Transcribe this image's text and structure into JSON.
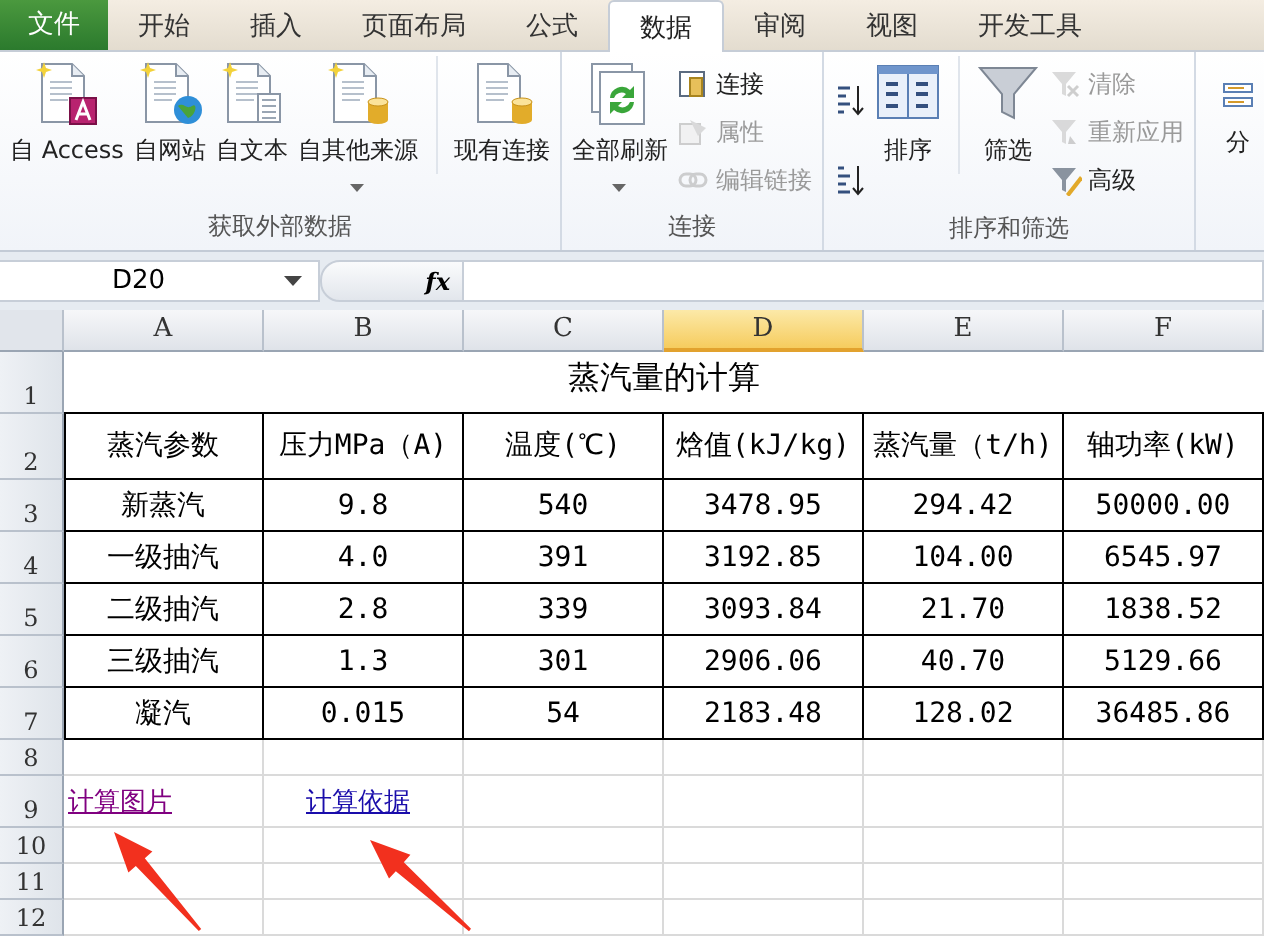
{
  "tabs": [
    {
      "label": "文件",
      "kind": "file",
      "selected": false
    },
    {
      "label": "开始",
      "kind": "tab",
      "selected": false
    },
    {
      "label": "插入",
      "kind": "tab",
      "selected": false
    },
    {
      "label": "页面布局",
      "kind": "tab",
      "selected": false
    },
    {
      "label": "公式",
      "kind": "tab",
      "selected": false
    },
    {
      "label": "数据",
      "kind": "tab",
      "selected": true
    },
    {
      "label": "审阅",
      "kind": "tab",
      "selected": false
    },
    {
      "label": "视图",
      "kind": "tab",
      "selected": false
    },
    {
      "label": "开发工具",
      "kind": "tab",
      "selected": false
    }
  ],
  "ribbon": {
    "groups": [
      {
        "label": "获取外部数据",
        "items": [
          {
            "kind": "large",
            "label": "自 Access",
            "dropdown": false
          },
          {
            "kind": "large",
            "label": "自网站",
            "dropdown": false
          },
          {
            "kind": "large",
            "label": "自文本",
            "dropdown": false
          },
          {
            "kind": "large",
            "label": "自其他来源",
            "dropdown": true
          },
          {
            "kind": "large",
            "label": "现有连接",
            "dropdown": false,
            "separated": true
          }
        ]
      },
      {
        "label": "连接",
        "items": [
          {
            "kind": "large",
            "label": "全部刷新",
            "dropdown": true
          },
          {
            "kind": "small",
            "label": "连接",
            "disabled": false
          },
          {
            "kind": "small",
            "label": "属性",
            "disabled": true
          },
          {
            "kind": "small",
            "label": "编辑链接",
            "disabled": true
          }
        ]
      },
      {
        "label": "排序和筛选",
        "items": [
          {
            "kind": "sort"
          },
          {
            "kind": "sort"
          },
          {
            "kind": "large",
            "label": "排序",
            "dropdown": false
          },
          {
            "kind": "large",
            "label": "筛选",
            "dropdown": false,
            "separated": true
          },
          {
            "kind": "small",
            "label": "清除",
            "disabled": true
          },
          {
            "kind": "small",
            "label": "重新应用",
            "disabled": true
          },
          {
            "kind": "small",
            "label": "高级",
            "disabled": false
          }
        ]
      },
      {
        "items": [
          {
            "kind": "large",
            "label": "分",
            "dropdown": false
          }
        ]
      }
    ]
  },
  "formula_bar": {
    "name_box": "D20",
    "fx": "fx"
  },
  "sheet": {
    "columns": [
      {
        "label": "A",
        "selected": false
      },
      {
        "label": "B",
        "selected": false
      },
      {
        "label": "C",
        "selected": false
      },
      {
        "label": "D",
        "selected": true
      },
      {
        "label": "E",
        "selected": false
      },
      {
        "label": "F",
        "selected": false
      }
    ],
    "rows": [
      {
        "number": "1",
        "kind": "title",
        "cells": [
          "蒸汽量的计算"
        ]
      },
      {
        "number": "2",
        "kind": "header",
        "cells": [
          "蒸汽参数",
          "压力MPa（A)",
          "温度(℃)",
          "焓值(kJ/kg)",
          "蒸汽量（t/h)",
          "轴功率(kW)"
        ]
      },
      {
        "number": "3",
        "kind": "data",
        "cells": [
          "新蒸汽",
          "9.8",
          "540",
          "3478.95",
          "294.42",
          "50000.00"
        ]
      },
      {
        "number": "4",
        "kind": "data",
        "cells": [
          "一级抽汽",
          "4.0",
          "391",
          "3192.85",
          "104.00",
          "6545.97"
        ]
      },
      {
        "number": "5",
        "kind": "data",
        "cells": [
          "二级抽汽",
          "2.8",
          "339",
          "3093.84",
          "21.70",
          "1838.52"
        ]
      },
      {
        "number": "6",
        "kind": "data",
        "cells": [
          "三级抽汽",
          "1.3",
          "301",
          "2906.06",
          "40.70",
          "5129.66"
        ]
      },
      {
        "number": "7",
        "kind": "data",
        "cells": [
          "凝汽",
          "0.015",
          "54",
          "2183.48",
          "128.02",
          "36485.86"
        ]
      },
      {
        "number": "8",
        "kind": "blank"
      },
      {
        "number": "9",
        "kind": "links",
        "links": [
          {
            "text": "计算图片",
            "visited": true
          },
          {
            "text": "计算依据",
            "visited": false
          }
        ]
      },
      {
        "number": "10",
        "kind": "blank"
      },
      {
        "number": "11",
        "kind": "blank"
      },
      {
        "number": "12",
        "kind": "blank"
      }
    ]
  },
  "annotations": [
    {
      "kind": "arrow"
    },
    {
      "kind": "arrow"
    }
  ]
}
